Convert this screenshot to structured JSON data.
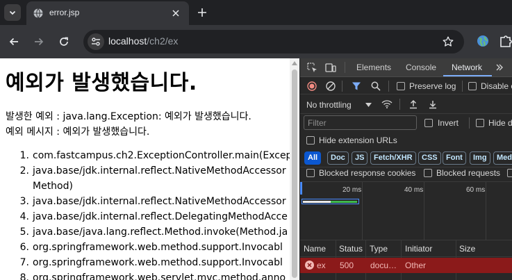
{
  "browser": {
    "tab": {
      "title": "error.jsp"
    },
    "address_bar": {
      "host": "localhost",
      "path": "/ch2/ex"
    }
  },
  "page": {
    "heading": "예외가 발생했습니다.",
    "exception_line": "발생한 예외 : java.lang.Exception: 예외가 발생했습니다.",
    "message_line": "예외 메시지 : 예외가 발생했습니다.",
    "stack_trace": [
      {
        "num": "1.",
        "text": "com.fastcampus.ch2.ExceptionController.main(Excep"
      },
      {
        "num": "2.",
        "text": "java.base/jdk.internal.reflect.NativeMethodAccessor"
      },
      {
        "num": "",
        "text": "Method)"
      },
      {
        "num": "3.",
        "text": "java.base/jdk.internal.reflect.NativeMethodAccessor"
      },
      {
        "num": "4.",
        "text": "java.base/jdk.internal.reflect.DelegatingMethodAcce"
      },
      {
        "num": "5.",
        "text": "java.base/java.lang.reflect.Method.invoke(Method.ja"
      },
      {
        "num": "6.",
        "text": "org.springframework.web.method.support.Invocabl"
      },
      {
        "num": "7.",
        "text": "org.springframework.web.method.support.Invocabl"
      },
      {
        "num": "8.",
        "text": "org.springframework.web.servlet.mvc.method.anno"
      }
    ]
  },
  "devtools": {
    "tabs": [
      "Elements",
      "Console",
      "Network"
    ],
    "active_tab": "Network",
    "preserve_log_label": "Preserve log",
    "disable_cache_label": "Disable c",
    "throttling_label": "No throttling",
    "filter_placeholder": "Filter",
    "invert_label": "Invert",
    "hide_data_label": "Hide d",
    "hide_extension_label": "Hide extension URLs",
    "type_filters": [
      "All",
      "Doc",
      "JS",
      "Fetch/XHR",
      "CSS",
      "Font",
      "Img",
      "Med"
    ],
    "active_type_filter": "All",
    "blocked_cookies_label": "Blocked response cookies",
    "blocked_requests_label": "Blocked requests",
    "timeline_labels": [
      "20 ms",
      "40 ms",
      "60 ms"
    ],
    "columns": [
      "Name",
      "Status",
      "Type",
      "Initiator",
      "Size"
    ],
    "requests": [
      {
        "name": "ex",
        "status": "500",
        "type": "docu…",
        "initiator": "Other",
        "size": ""
      }
    ]
  },
  "colors": {
    "devtools_accent": "#7cacf8",
    "error_row_bg": "#8b1a1a",
    "error_text": "#f2b8b5",
    "active_chip": "#0b57d0"
  }
}
